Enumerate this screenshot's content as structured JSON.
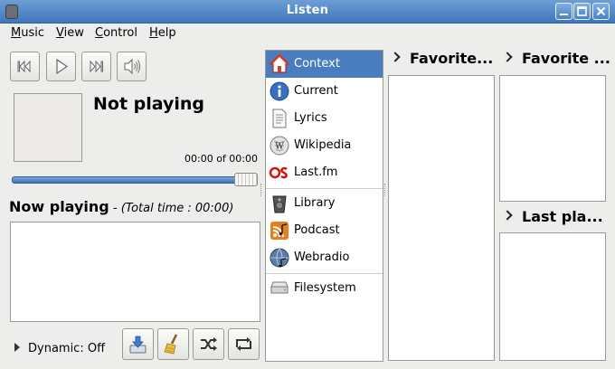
{
  "window": {
    "title": "Listen"
  },
  "titlebar": {
    "buttons": [
      "minimize-icon",
      "maximize-icon",
      "close-icon"
    ]
  },
  "menu": {
    "items": [
      {
        "label": "Music"
      },
      {
        "label": "View"
      },
      {
        "label": "Control"
      },
      {
        "label": "Help"
      }
    ]
  },
  "player": {
    "controls": [
      "previous-track-icon",
      "play-icon",
      "next-track-icon",
      "volume-icon"
    ],
    "title": "Not playing",
    "time": "00:00 of 00:00",
    "progress": 1.0
  },
  "now_playing": {
    "heading": "Now playing",
    "total": "- (Total time : 00:00)"
  },
  "dynamic": {
    "label": "Dynamic: Off"
  },
  "actions": [
    "save-playlist-icon",
    "clear-playlist-icon",
    "shuffle-icon",
    "repeat-icon"
  ],
  "sources": {
    "items": [
      {
        "label": "Context",
        "icon": "home-icon",
        "selected": true
      },
      {
        "label": "Current",
        "icon": "info-icon"
      },
      {
        "label": "Lyrics",
        "icon": "document-icon"
      },
      {
        "label": "Wikipedia",
        "icon": "wikipedia-icon"
      },
      {
        "label": "Last.fm",
        "icon": "lastfm-icon"
      },
      {
        "label": "Library",
        "icon": "library-icon"
      },
      {
        "label": "Podcast",
        "icon": "podcast-icon"
      },
      {
        "label": "Webradio",
        "icon": "globe-icon"
      },
      {
        "label": "Filesystem",
        "icon": "drive-icon"
      }
    ]
  },
  "panes": {
    "favorite_1": "Favorite...",
    "favorite_2": "Favorite ...",
    "last_played": "Last pla..."
  },
  "colors": {
    "titlebar": "#4a82c4",
    "selection": "#4a7cc0",
    "lastfm_red": "#d51007"
  }
}
